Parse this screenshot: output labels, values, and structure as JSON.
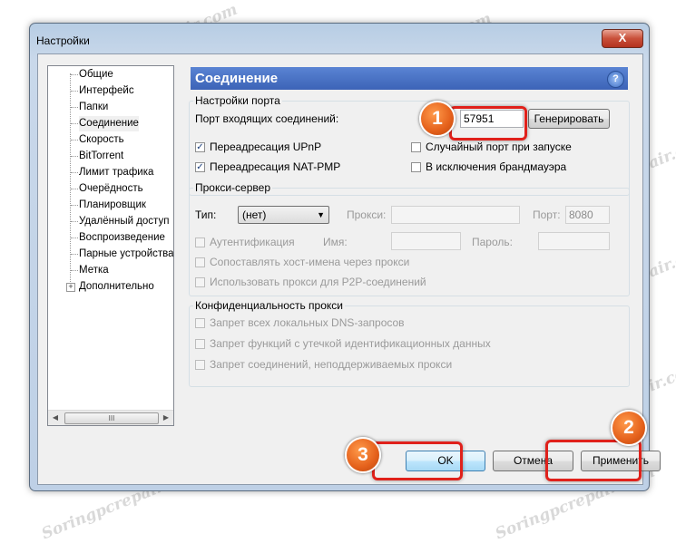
{
  "window": {
    "title": "Настройки",
    "close_glyph": "X"
  },
  "sidebar": {
    "items": [
      {
        "label": "Общие"
      },
      {
        "label": "Интерфейс"
      },
      {
        "label": "Папки"
      },
      {
        "label": "Соединение",
        "selected": true
      },
      {
        "label": "Скорость"
      },
      {
        "label": "BitTorrent"
      },
      {
        "label": "Лимит трафика"
      },
      {
        "label": "Очерёдность"
      },
      {
        "label": "Планировщик"
      },
      {
        "label": "Удалённый доступ"
      },
      {
        "label": "Воспроизведение"
      },
      {
        "label": "Парные устройства"
      },
      {
        "label": "Метка"
      },
      {
        "label": "Дополнительно",
        "expandable": true
      }
    ],
    "scrollbar_grip": "III"
  },
  "panel": {
    "title": "Соединение",
    "help_glyph": "?"
  },
  "port": {
    "legend": "Настройки порта",
    "incoming_label": "Порт входящих соединений:",
    "port_value": "57951",
    "generate_label": "Генерировать",
    "upnp_label": "Переадресация UPnP",
    "upnp_checked": true,
    "natpmp_label": "Переадресация NAT-PMP",
    "natpmp_checked": true,
    "random_label": "Случайный порт при запуске",
    "random_checked": false,
    "firewall_label": "В исключения брандмауэра",
    "firewall_checked": false
  },
  "proxy": {
    "legend": "Прокси-сервер",
    "type_label": "Тип:",
    "type_value": "(нет)",
    "proxy_label": "Прокси:",
    "proxy_value": "",
    "port_label": "Порт:",
    "port_value": "8080",
    "auth_label": "Аутентификация",
    "name_label": "Имя:",
    "password_label": "Пароль:",
    "resolve_label": "Сопоставлять хост-имена через прокси",
    "p2p_label": "Использовать прокси для P2P-соединений"
  },
  "privacy": {
    "legend": "Конфиденциальность прокси",
    "dns_label": "Запрет всех локальных DNS-запросов",
    "leak_label": "Запрет функций с утечкой идентификационных данных",
    "unsupported_label": "Запрет соединений, неподдерживаемых прокси"
  },
  "buttons": {
    "ok": "OK",
    "cancel": "Отмена",
    "apply": "Применить"
  },
  "annotations": {
    "one": "1",
    "two": "2",
    "three": "3",
    "accent": "#e0211b"
  },
  "watermark": "Soringpcrepair.com"
}
